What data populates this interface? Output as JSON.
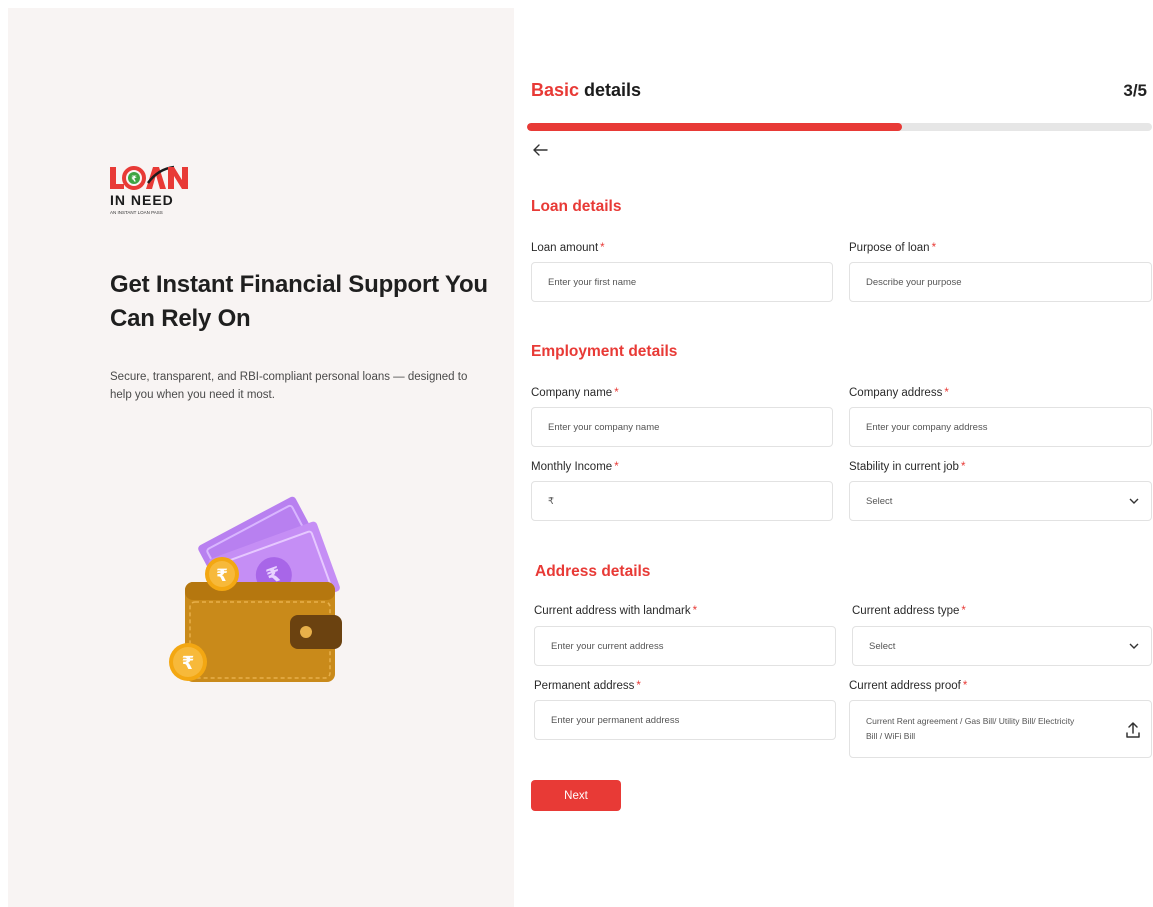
{
  "brand": {
    "logo_text": "LOAN",
    "logo_sub": "IN NEED",
    "logo_tagline": "AN INSTANT LOAN PASS",
    "accent_color": "#e83a36"
  },
  "hero": {
    "title": "Get Instant Financial Support You Can Rely On",
    "subtitle": "Secure, transparent, and RBI-compliant personal loans — designed to help you when you need it most."
  },
  "header": {
    "title_accent": "Basic",
    "title_rest": " details",
    "step": "3/5",
    "progress_fraction": 0.6
  },
  "icons": {
    "back": "arrow-left-icon",
    "select": "chevron-down-icon",
    "upload": "upload-icon",
    "currency": "₹"
  },
  "sections": {
    "loan": {
      "title": "Loan details",
      "loan_amount": {
        "label": "Loan amount",
        "placeholder": "Enter your first name"
      },
      "purpose": {
        "label": "Purpose of loan",
        "placeholder": "Describe your purpose"
      }
    },
    "employment": {
      "title": "Employment details",
      "company_name": {
        "label": "Company name",
        "placeholder": "Enter your company name"
      },
      "company_address": {
        "label": "Company address",
        "placeholder": "Enter your company address"
      },
      "monthly_income": {
        "label": "Monthly Income",
        "placeholder": "₹"
      },
      "stability": {
        "label": "Stability in current job",
        "value": "Select"
      }
    },
    "address": {
      "title": "Address details",
      "current_address": {
        "label": "Current address with landmark",
        "placeholder": "Enter your current address"
      },
      "address_type": {
        "label": "Current address type",
        "value": "Select"
      },
      "permanent_address": {
        "label": "Permanent address",
        "placeholder": "Enter your permanent address"
      },
      "address_proof": {
        "label": "Current address proof",
        "placeholder": "Current Rent agreement / Gas Bill/ Utility Bill/ Electricity Bill / WiFi Bill"
      }
    }
  },
  "required_marker": "*",
  "actions": {
    "next_label": "Next"
  }
}
